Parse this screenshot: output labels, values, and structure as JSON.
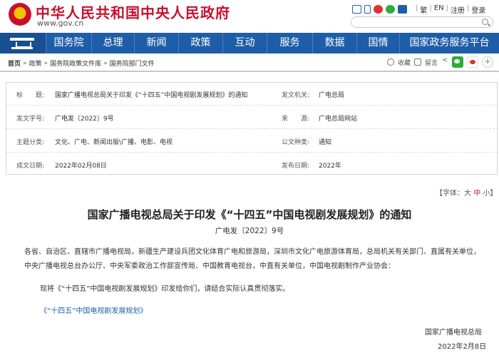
{
  "header": {
    "site_title": "中华人民共和国中央人民政府",
    "site_url": "www.gov.cn",
    "top_links": [
      "繁",
      "EN",
      "注册",
      "登录"
    ],
    "top_link_separators": [
      "|",
      "|",
      "|",
      "|"
    ],
    "search_placeholder": ""
  },
  "nav": {
    "items": [
      "国务院",
      "总理",
      "新闻",
      "政策",
      "互动",
      "服务",
      "数据",
      "国情",
      "国家政务服务平台"
    ]
  },
  "breadcrumb": {
    "items": [
      "首页",
      "政策",
      "国务院政策文件库",
      "国务院部门文件"
    ],
    "arrow": "»"
  },
  "tools": {
    "favorite": "收藏",
    "comment": "留言",
    "plus": "+"
  },
  "info": {
    "title_label": "标　　题:",
    "title_value": "国家广播电视总局关于印发《“十四五”中国电视剧发展规划》的通知",
    "issuer_label": "发文机关:",
    "issuer_value": "广电总局",
    "doc_no_label": "发文字号:",
    "doc_no_value": "广电发〔2022〕9号",
    "source_label": "来　　源:",
    "source_value": "广电总局网站",
    "topic_label": "主题分类:",
    "topic_value": "文化、广电、新闻出版\\广播、电影、电视",
    "type_label": "公文种类:",
    "type_value": "通知",
    "written_label": "成文日期:",
    "written_value": "2022年02月08日",
    "published_label": "发布日期:",
    "published_value": "2022年"
  },
  "font_size": {
    "prefix": "【字体：",
    "big": "大",
    "mid": "中",
    "small": "小",
    "suffix": "】"
  },
  "document": {
    "title": "国家广播电视总局关于印发《“十四五”中国电视剧发展规划》的通知",
    "number": "广电发〔2022〕9号",
    "recipients": "各省、自治区、直辖市广播电视局，新疆生产建设兵团文化体育广电和旅游局，深圳市文化广电旅游体育局，总局机关有关部门、直属有关单位，中央广播电视总台办公厅、中央军委政治工作部宣传局、中国教育电视台，中直有关单位，中国电视剧制作产业协会：",
    "body": "现将《“十四五”中国电视剧发展规划》印发给你们，请结合实际认真贯彻落实。",
    "attachment_link": "《“十四五”中国电视剧发展规划》",
    "sign_org": "国家广播电视总局",
    "sign_date": "2022年2月8日"
  },
  "colors": {
    "brand_red": "#c8102e",
    "nav_blue": "#1e5ea8",
    "link_blue": "#1f5fa8"
  }
}
